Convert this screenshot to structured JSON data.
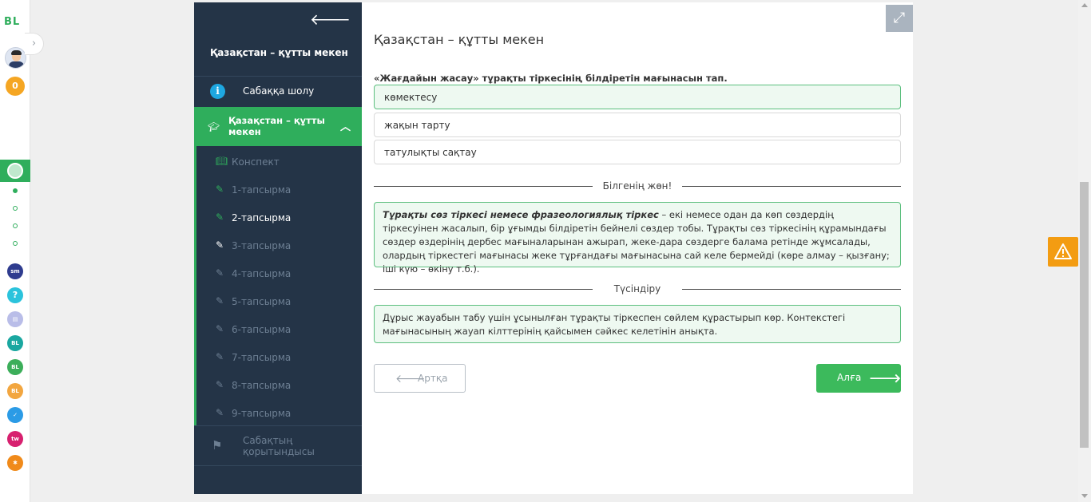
{
  "rail": {
    "logo": "BL",
    "coins": "0",
    "apps": [
      "smart-lesson-icon",
      "help-icon",
      "test-icon",
      "bilim-icon",
      "bilim-green-icon",
      "bilimstep-icon",
      "tasks-icon",
      "twig-icon",
      "bilimland-icon"
    ]
  },
  "sidebar": {
    "lesson_title": "Қазақстан – құтты мекен",
    "overview_label": "Сабаққа шолу",
    "lesson_label": "Қазақстан – құтты мекен",
    "items": [
      {
        "label": "Конспект"
      },
      {
        "label": "1-тапсырма"
      },
      {
        "label": "2-тапсырма"
      },
      {
        "label": "3-тапсырма"
      },
      {
        "label": "4-тапсырма"
      },
      {
        "label": "5-тапсырма"
      },
      {
        "label": "6-тапсырма"
      },
      {
        "label": "7-тапсырма"
      },
      {
        "label": "8-тапсырма"
      },
      {
        "label": "9-тапсырма"
      }
    ],
    "result_label": "Сабақтың қорытындысы"
  },
  "main": {
    "title": "Қазақстан – құтты мекен",
    "question": "«Жағдайын жасау» тұрақты тіркесінің білдіретін мағынасын тап.",
    "options": [
      "көмектесу",
      "жақын тарту",
      "татулықты сақтау"
    ],
    "selected_index": 0,
    "know_heading": "Білгенің жөн!",
    "know_term": "Тұрақты сөз тіркесі немесе фразеологиялық тіркес",
    "know_text": " – екі немесе одан да көп сөздердің тіркесуінен жасалып, бір ұғымды білдіретін бейнелі сөздер тобы. Тұрақты сөз тіркесінің құрамындағы сөздер өздерінің дербес мағыналарынан ажырап, жеке-дара сөздерге балама ретінде жұмсалады, олардың тіркестегі мағынасы жеке тұрғандағы мағынасына сай келе бермейді (көре алмау – қызғану; іші күю – өкіну т.б.).",
    "explain_heading": "Түсіндіру",
    "explain_text": "Дұрыс жауабын табу үшін ұсынылған тұрақты тіркеспен сөйлем құрастырып көр. Контекстегі мағынасының жауап кілттерінің қайсымен сәйкес келетінін анықта.",
    "back_label": "Артқа",
    "next_label": "Алға"
  },
  "colors": {
    "sidebar_bg": "#243447",
    "accent": "#2fae5c",
    "next_button": "#3cba5c",
    "warning": "#f39c12"
  }
}
